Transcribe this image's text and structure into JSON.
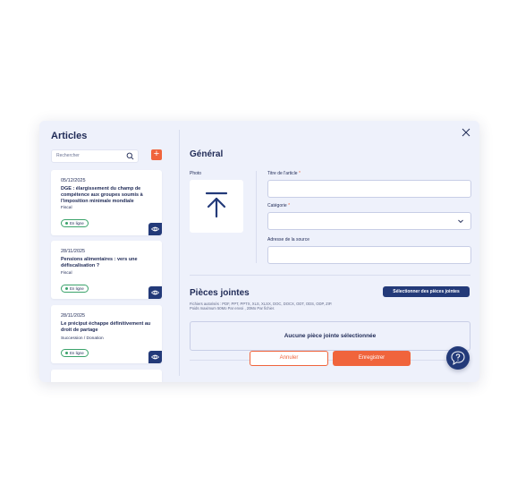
{
  "sidebar": {
    "title": "Articles",
    "search_placeholder": "Rechercher",
    "add_label": "+",
    "cards": [
      {
        "date": "05/12/2025",
        "title": "DGE : élargissement du champ de compétence aux groupes soumis à l'imposition minimale mondiale",
        "category": "Fiscal",
        "status": "En ligne"
      },
      {
        "date": "28/11/2025",
        "title": "Pensions alimentaires : vers une défiscalisation ?",
        "category": "Fiscal",
        "status": "En ligne"
      },
      {
        "date": "28/11/2025",
        "title": "Le préciput échappe définitivement au droit de partage",
        "category": "Succession / Donation",
        "status": "En ligne"
      }
    ]
  },
  "general": {
    "section_title": "Général",
    "photo_label": "Photo",
    "title_label": "Titre de l'article",
    "category_label": "Catégorie",
    "source_label": "Adresse de la source",
    "required_mark": "*"
  },
  "attachments": {
    "section_title": "Pièces jointes",
    "select_button": "Sélectionner des pièces jointes",
    "help_line1": "Fichiers autorisés : PDF, PPT, PPTX, XLS, XLSX, DOC, DOCX, ODT, ODS, ODP, ZIP.",
    "help_line2": "Poids maximum 50Mo Par envoi , 20Mo Par fichier.",
    "empty_text": "Aucune pièce jointe sélectionnée"
  },
  "actions": {
    "cancel": "Annuler",
    "save": "Enregistrer"
  },
  "colors": {
    "accent": "#f0643c",
    "navy": "#233a79",
    "panel": "#eef1fb",
    "online": "#3ba36b"
  }
}
